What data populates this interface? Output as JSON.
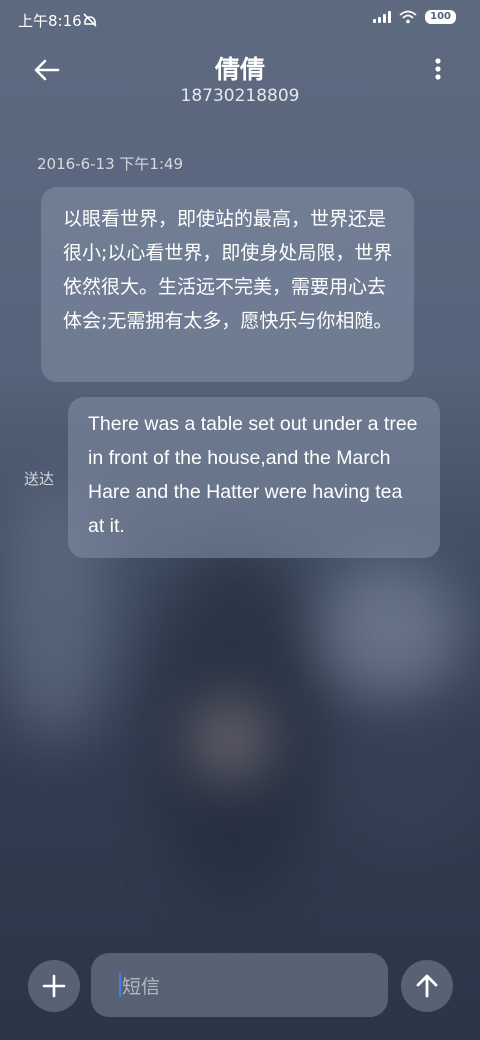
{
  "status_bar": {
    "time": "上午8:16",
    "battery": "100"
  },
  "header": {
    "contact_name": "倩倩",
    "contact_number": "18730218809"
  },
  "conversation": {
    "timestamp": "2016-6-13 下午1:49",
    "messages": [
      {
        "direction": "incoming",
        "text": "以眼看世界，即使站的最高，世界还是很小;以心看世界，即使身处局限，世界依然很大。生活远不完美，需要用心去体会;无需拥有太多，愿快乐与你相随。"
      },
      {
        "direction": "outgoing",
        "text": "There was a table set out under a tree in front of the house,and the March Hare and the Hatter were having tea at it.",
        "status": "送达"
      }
    ]
  },
  "composer": {
    "placeholder": "短信"
  },
  "icons": {
    "back": "arrow-left-icon",
    "menu": "more-vertical-icon",
    "add": "plus-icon",
    "send": "arrow-up-icon",
    "status": [
      "do-not-disturb-icon",
      "signal-icon",
      "wifi-icon",
      "battery-icon"
    ]
  }
}
